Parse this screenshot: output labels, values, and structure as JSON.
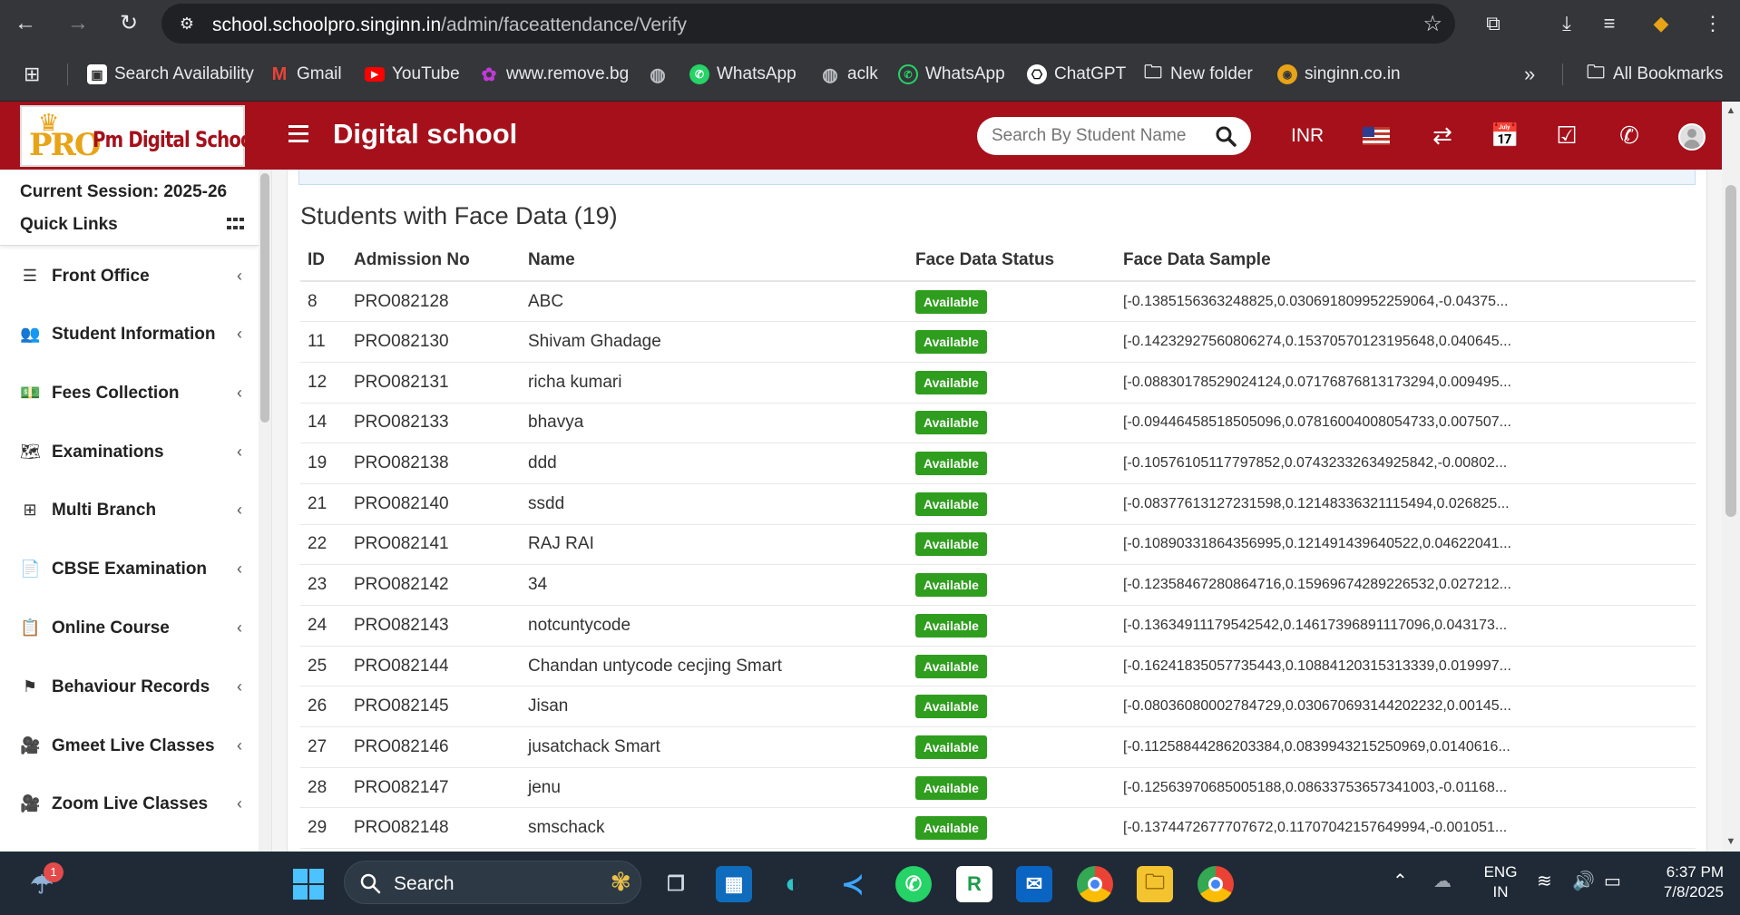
{
  "browser": {
    "url_host": "school.schoolpro.singinn.in",
    "url_path": "/admin/faceattendance/Verify",
    "bookmarks": [
      {
        "label": "Search Availability",
        "icon": "search-availability-icon"
      },
      {
        "label": "Gmail",
        "icon": "gmail-icon"
      },
      {
        "label": "YouTube",
        "icon": "youtube-icon"
      },
      {
        "label": "www.remove.bg",
        "icon": "removebg-icon"
      },
      {
        "label": "",
        "icon": "globe-icon"
      },
      {
        "label": "WhatsApp",
        "icon": "whatsapp-icon"
      },
      {
        "label": "aclk",
        "icon": "globe-icon"
      },
      {
        "label": "WhatsApp",
        "icon": "whatsapp-icon"
      },
      {
        "label": "ChatGPT",
        "icon": "chatgpt-icon"
      },
      {
        "label": "New folder",
        "icon": "folder-icon"
      },
      {
        "label": "singinn.co.in",
        "icon": "singinn-icon"
      }
    ],
    "more_label": "»",
    "all_bookmarks": "All Bookmarks"
  },
  "header": {
    "logo_pro": "PRO",
    "logo_name": "Pm Digital School",
    "title": "Digital school",
    "search_placeholder": "Search By Student Name",
    "currency": "INR"
  },
  "sidebar": {
    "session": "Current Session: 2025-26",
    "quick_links": "Quick Links",
    "items": [
      {
        "label": "Front Office",
        "icon": "front-office-icon",
        "glyph": "☰"
      },
      {
        "label": "Student Information",
        "icon": "student-info-icon",
        "glyph": "👥"
      },
      {
        "label": "Fees Collection",
        "icon": "money-icon",
        "glyph": "💵"
      },
      {
        "label": "Examinations",
        "icon": "map-icon",
        "glyph": "🗺"
      },
      {
        "label": "Multi Branch",
        "icon": "sitemap-icon",
        "glyph": "⊞"
      },
      {
        "label": "CBSE Examination",
        "icon": "document-icon",
        "glyph": "📄"
      },
      {
        "label": "Online Course",
        "icon": "course-icon",
        "glyph": "📋"
      },
      {
        "label": "Behaviour Records",
        "icon": "signpost-icon",
        "glyph": "⚑"
      },
      {
        "label": "Gmeet Live Classes",
        "icon": "video-icon",
        "glyph": "🎥"
      },
      {
        "label": "Zoom Live Classes",
        "icon": "video-icon",
        "glyph": "🎥"
      }
    ]
  },
  "main": {
    "title": "Students with Face Data (19)",
    "columns": [
      "ID",
      "Admission No",
      "Name",
      "Face Data Status",
      "Face Data Sample"
    ],
    "rows": [
      {
        "id": "8",
        "admission": "PRO082128",
        "name": "ABC",
        "status": "Available",
        "sample": "[-0.1385156363248825,0.030691809952259064,-0.04375..."
      },
      {
        "id": "11",
        "admission": "PRO082130",
        "name": "Shivam Ghadage",
        "status": "Available",
        "sample": "[-0.14232927560806274,0.15370570123195648,0.040645..."
      },
      {
        "id": "12",
        "admission": "PRO082131",
        "name": "richa kumari",
        "status": "Available",
        "sample": "[-0.08830178529024124,0.07176876813173294,0.009495..."
      },
      {
        "id": "14",
        "admission": "PRO082133",
        "name": "bhavya",
        "status": "Available",
        "sample": "[-0.09446458518505096,0.07816004008054733,0.007507..."
      },
      {
        "id": "19",
        "admission": "PRO082138",
        "name": "ddd",
        "status": "Available",
        "sample": "[-0.10576105117797852,0.07432332634925842,-0.00802..."
      },
      {
        "id": "21",
        "admission": "PRO082140",
        "name": "ssdd",
        "status": "Available",
        "sample": "[-0.08377613127231598,0.12148336321115494,0.026825..."
      },
      {
        "id": "22",
        "admission": "PRO082141",
        "name": "RAJ RAI",
        "status": "Available",
        "sample": "[-0.10890331864356995,0.121491439640522,0.04622041..."
      },
      {
        "id": "23",
        "admission": "PRO082142",
        "name": "34",
        "status": "Available",
        "sample": "[-0.12358467280864716,0.15969674289226532,0.027212..."
      },
      {
        "id": "24",
        "admission": "PRO082143",
        "name": "notcuntycode",
        "status": "Available",
        "sample": "[-0.13634911179542542,0.14617396891117096,0.043173..."
      },
      {
        "id": "25",
        "admission": "PRO082144",
        "name": "Chandan untycode cecjing Smart",
        "status": "Available",
        "sample": "[-0.16241835057735443,0.10884120315313339,0.019997..."
      },
      {
        "id": "26",
        "admission": "PRO082145",
        "name": "Jisan",
        "status": "Available",
        "sample": "[-0.08036080002784729,0.030670693144202232,0.00145..."
      },
      {
        "id": "27",
        "admission": "PRO082146",
        "name": "jusatchack Smart",
        "status": "Available",
        "sample": "[-0.11258844286203384,0.0839943215250969,0.0140616..."
      },
      {
        "id": "28",
        "admission": "PRO082147",
        "name": "jenu",
        "status": "Available",
        "sample": "[-0.12563970685005188,0.08633753657341003,-0.01168..."
      },
      {
        "id": "29",
        "admission": "PRO082148",
        "name": "smschack",
        "status": "Available",
        "sample": "[-0.1374472677707672,0.11707042157649994,-0.001051..."
      }
    ],
    "badge_color": "#2f9e1e"
  },
  "taskbar": {
    "search_label": "Search",
    "notification_count": "1",
    "lang": "ENG",
    "region": "IN",
    "time": "6:37 PM",
    "date": "7/8/2025"
  },
  "colors": {
    "header_bg": "#a5101b",
    "chrome_bg": "#35363a",
    "taskbar_bg": "#1f2a36"
  }
}
